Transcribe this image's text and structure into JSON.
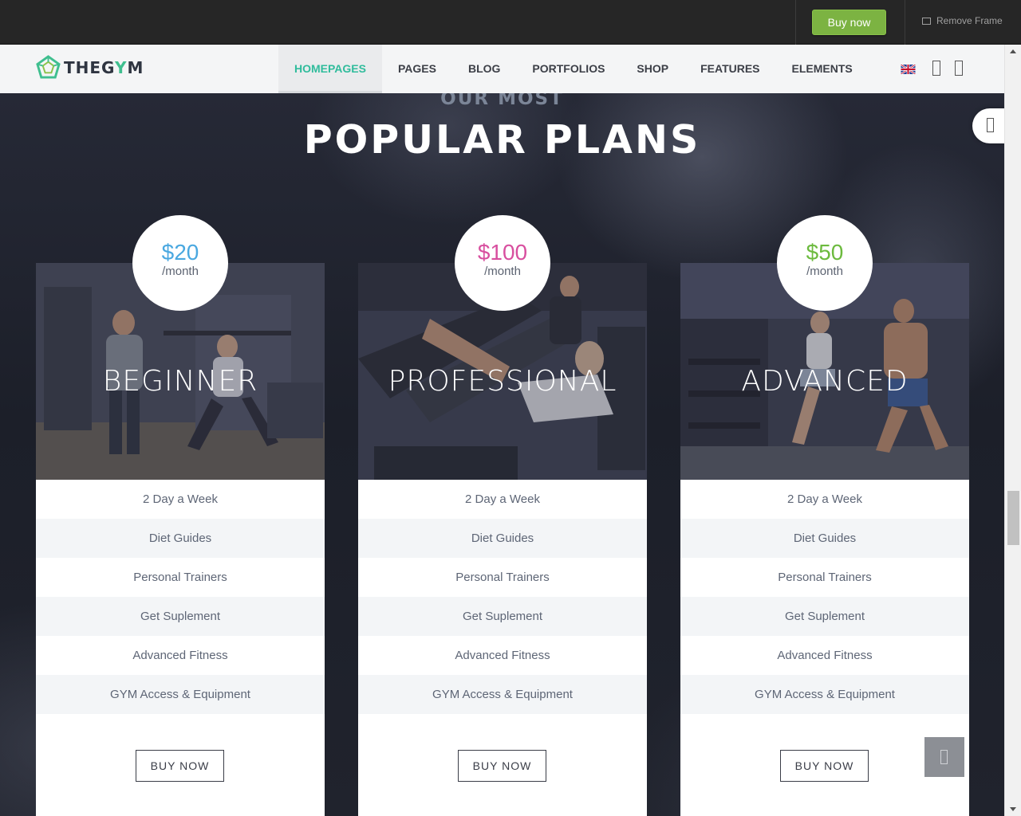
{
  "frame": {
    "buy_now": "Buy now",
    "remove_frame": "Remove Frame"
  },
  "logo": {
    "prefix": "THEG",
    "accent": "Y",
    "suffix": "M"
  },
  "nav": [
    {
      "label": "HOMEPAGES",
      "active": true
    },
    {
      "label": "PAGES"
    },
    {
      "label": "BLOG"
    },
    {
      "label": "PORTFOLIOS"
    },
    {
      "label": "SHOP"
    },
    {
      "label": "FEATURES"
    },
    {
      "label": "ELEMENTS"
    }
  ],
  "nav_icons": [
    "uk-flag-icon",
    "search-icon",
    "cart-icon"
  ],
  "section": {
    "eyebrow": "OUR MOST",
    "heading": "POPULAR PLANS"
  },
  "plans": [
    {
      "name": "BEGINNER",
      "price": "$20",
      "per": "/month",
      "price_color": "#4aa8e0",
      "features": [
        "2 Day a Week",
        "Diet Guides",
        "Personal Trainers",
        "Get Suplement",
        "Advanced Fitness",
        "GYM Access & Equipment"
      ],
      "button": "BUY NOW"
    },
    {
      "name": "PROFESSIONAL",
      "price": "$100",
      "per": "/month",
      "price_color": "#d84f9f",
      "features": [
        "2 Day a Week",
        "Diet Guides",
        "Personal Trainers",
        "Get Suplement",
        "Advanced Fitness",
        "GYM Access & Equipment"
      ],
      "button": "BUY NOW"
    },
    {
      "name": "ADVANCED",
      "price": "$50",
      "per": "/month",
      "price_color": "#6cba3e",
      "features": [
        "2 Day a Week",
        "Diet Guides",
        "Personal Trainers",
        "Get Suplement",
        "Advanced Fitness",
        "GYM Access & Equipment"
      ],
      "button": "BUY NOW"
    }
  ],
  "colors": {
    "accent_green": "#30bc9c",
    "buy_button": "#7cb342"
  }
}
